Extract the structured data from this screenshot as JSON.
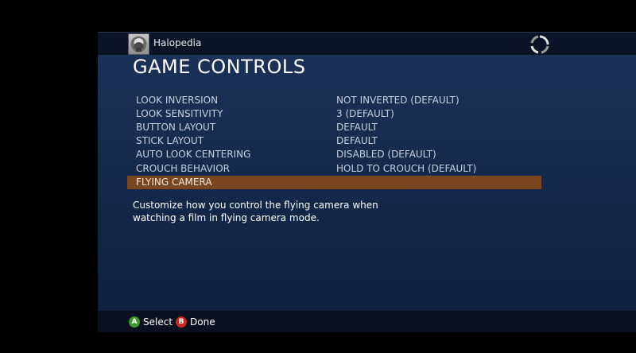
{
  "header": {
    "app_name": "Halopedia"
  },
  "page": {
    "title": "GAME CONTROLS",
    "description": "Customize how you control the flying camera when watching a film in flying camera mode."
  },
  "settings": [
    {
      "label": "LOOK INVERSION",
      "value": "NOT INVERTED (DEFAULT)"
    },
    {
      "label": "LOOK SENSITIVITY",
      "value": "3 (DEFAULT)"
    },
    {
      "label": "BUTTON LAYOUT",
      "value": "DEFAULT"
    },
    {
      "label": "STICK LAYOUT",
      "value": "DEFAULT"
    },
    {
      "label": "AUTO LOOK CENTERING",
      "value": "DISABLED (DEFAULT)"
    },
    {
      "label": "CROUCH BEHAVIOR",
      "value": "HOLD TO CROUCH (DEFAULT)"
    },
    {
      "label": "FLYING CAMERA",
      "value": ""
    }
  ],
  "selected_index": 6,
  "footer": {
    "select_button_glyph": "A",
    "select_label": "Select",
    "done_button_glyph": "B",
    "done_label": "Done"
  },
  "colors": {
    "selection_highlight": "#7a4620",
    "a_button": "#3c9a2a",
    "b_button": "#c8281e",
    "background": "#142a4c"
  },
  "icons": {
    "avatar": "halo-logo-icon",
    "loading": "loading-spinner-icon"
  }
}
